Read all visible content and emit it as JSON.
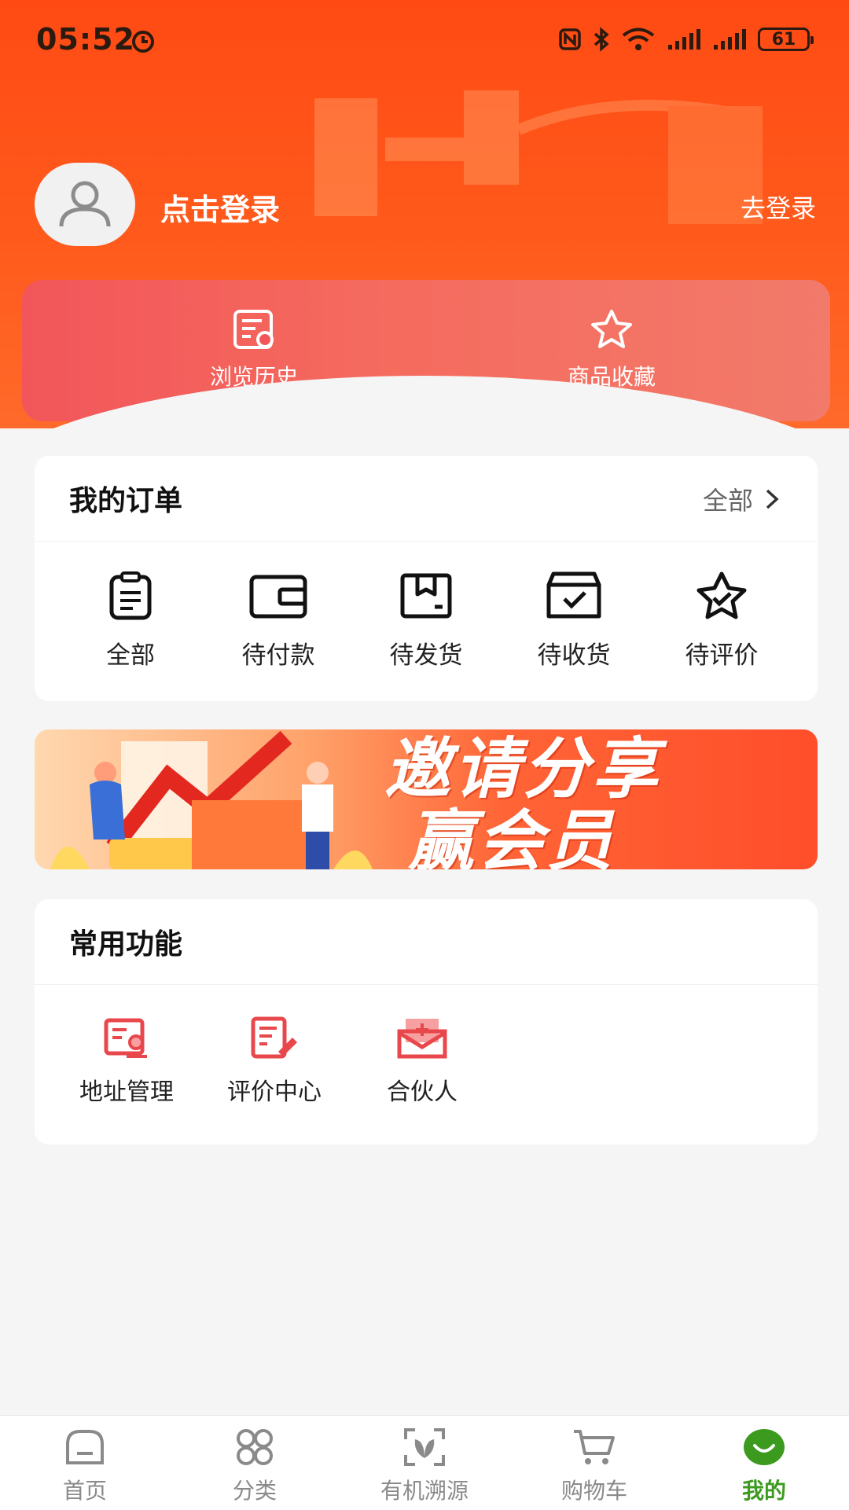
{
  "status_bar": {
    "time": "05:52",
    "battery": "61"
  },
  "header": {
    "login_title": "点击登录",
    "go_login": "去登录",
    "quick_links": [
      {
        "label": "浏览历史",
        "icon": "history-icon"
      },
      {
        "label": "商品收藏",
        "icon": "star-icon"
      }
    ]
  },
  "orders": {
    "title": "我的订单",
    "more": "全部",
    "items": [
      {
        "label": "全部",
        "icon": "clipboard-icon"
      },
      {
        "label": "待付款",
        "icon": "wallet-icon"
      },
      {
        "label": "待发货",
        "icon": "box-icon"
      },
      {
        "label": "待收货",
        "icon": "receive-box-icon"
      },
      {
        "label": "待评价",
        "icon": "star-check-icon"
      }
    ]
  },
  "banner": {
    "line1": "邀请分享",
    "line2": "赢会员"
  },
  "functions": {
    "title": "常用功能",
    "items": [
      {
        "label": "地址管理",
        "icon": "address-icon"
      },
      {
        "label": "评价中心",
        "icon": "review-icon"
      },
      {
        "label": "合伙人",
        "icon": "partner-mail-icon"
      }
    ]
  },
  "bottom_nav": {
    "items": [
      {
        "label": "首页",
        "icon": "home-icon"
      },
      {
        "label": "分类",
        "icon": "category-icon"
      },
      {
        "label": "有机溯源",
        "icon": "trace-scan-icon"
      },
      {
        "label": "购物车",
        "icon": "cart-icon"
      },
      {
        "label": "我的",
        "icon": "profile-smile-icon",
        "active": true
      }
    ]
  },
  "colors": {
    "brand_orange": "#ff4a14",
    "active_green": "#3c9a1f",
    "icon_red": "#e8474b"
  }
}
